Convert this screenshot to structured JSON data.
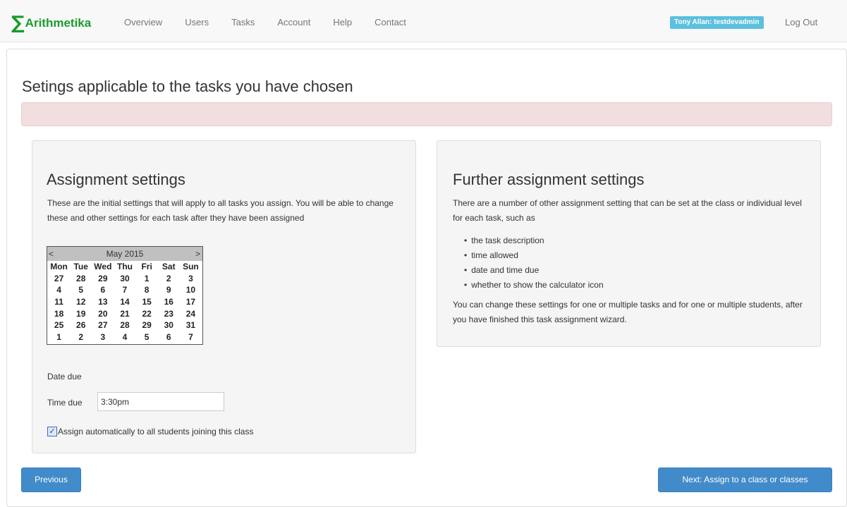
{
  "nav": {
    "brand": "Arithmetika",
    "brand_symbol": "∑",
    "links": [
      "Overview",
      "Users",
      "Tasks",
      "Account",
      "Help",
      "Contact"
    ],
    "user": "Tony Allan: testdevadmin",
    "logout": "Log Out"
  },
  "page": {
    "title": "Setings applicable to the tasks you have chosen"
  },
  "assignment": {
    "heading": "Assignment settings",
    "intro": "These are the initial settings that will apply to all tasks you assign. You will be able to change these and other settings for each task after they have been assigned",
    "calendar": {
      "prev": "<",
      "next": ">",
      "month": "May 2015",
      "weekdays": [
        "Mon",
        "Tue",
        "Wed",
        "Thu",
        "Fri",
        "Sat",
        "Sun"
      ],
      "weeks": [
        [
          "27",
          "28",
          "29",
          "30",
          "1",
          "2",
          "3"
        ],
        [
          "4",
          "5",
          "6",
          "7",
          "8",
          "9",
          "10"
        ],
        [
          "11",
          "12",
          "13",
          "14",
          "15",
          "16",
          "17"
        ],
        [
          "18",
          "19",
          "20",
          "21",
          "22",
          "23",
          "24"
        ],
        [
          "25",
          "26",
          "27",
          "28",
          "29",
          "30",
          "31"
        ],
        [
          "1",
          "2",
          "3",
          "4",
          "5",
          "6",
          "7"
        ]
      ]
    },
    "date_due_label": "Date due",
    "time_due_label": "Time due",
    "time_due_value": "3:30pm",
    "auto_assign_label": "Assign automatically to all students joining this class",
    "auto_assign_checked": true
  },
  "further": {
    "heading": "Further assignment settings",
    "intro": "There are a number of other assignment setting that can be set at the class or individual level for each task, such as",
    "bullets": [
      "the task description",
      "time allowed",
      "date and time due",
      "whether to show the calculator icon"
    ],
    "outro": "You can change these settings for one or multiple tasks and for one or multiple students, after you have finished this task assignment wizard."
  },
  "buttons": {
    "previous": "Previous",
    "next": "Next: Assign to a class or classes"
  },
  "colors": {
    "brand": "#1a9b2b",
    "primary": "#428bca",
    "badge": "#5bc0de",
    "alert": "#f2dede"
  }
}
